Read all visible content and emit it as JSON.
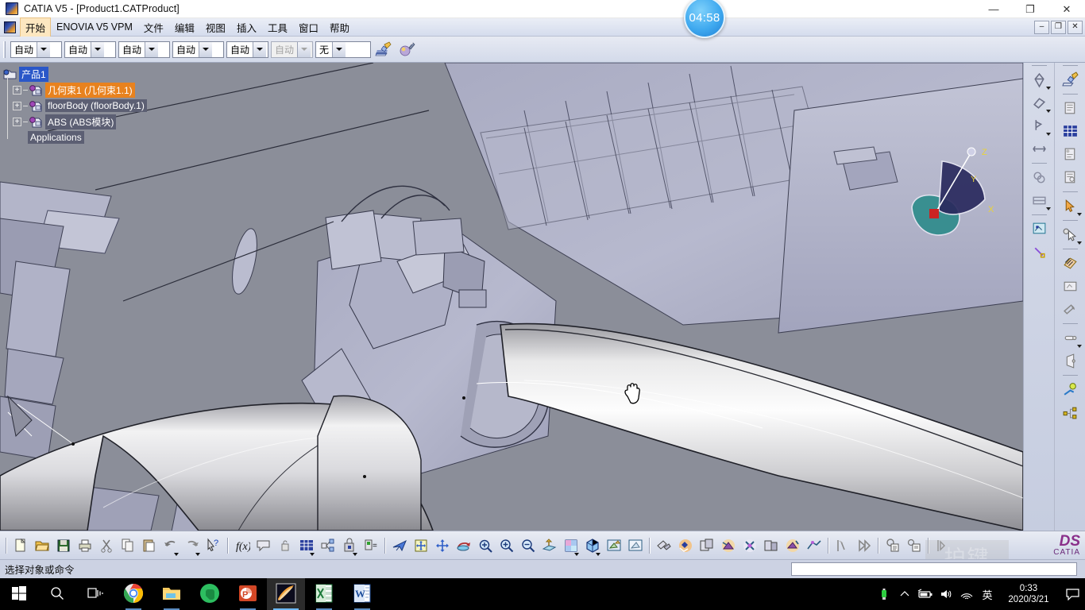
{
  "window": {
    "title": "CATIA V5 - [Product1.CATProduct]",
    "app_icon": "catia-icon",
    "minimize": "—",
    "maximize": "❐",
    "close": "✕"
  },
  "mdi": {
    "minimize": "–",
    "restore": "❐",
    "close": "✕"
  },
  "menubar": {
    "items": [
      {
        "label": "开始",
        "name": "menu-start",
        "active": true
      },
      {
        "label": "ENOVIA V5 VPM",
        "name": "menu-enovia",
        "active": false
      },
      {
        "label": "文件",
        "name": "menu-file",
        "active": false
      },
      {
        "label": "编辑",
        "name": "menu-edit",
        "active": false
      },
      {
        "label": "视图",
        "name": "menu-view",
        "active": false
      },
      {
        "label": "插入",
        "name": "menu-insert",
        "active": false
      },
      {
        "label": "工具",
        "name": "menu-tools",
        "active": false
      },
      {
        "label": "窗口",
        "name": "menu-window",
        "active": false
      },
      {
        "label": "帮助",
        "name": "menu-help",
        "active": false
      }
    ]
  },
  "toolbar_top": {
    "combos": [
      {
        "name": "combo-part-number",
        "value": "自动",
        "width": "c-w1",
        "disabled": false
      },
      {
        "name": "combo-instance-name",
        "value": "自动",
        "width": "c-w1",
        "disabled": false
      },
      {
        "name": "combo-nomenclature",
        "value": "自动",
        "width": "c-w1",
        "disabled": false
      },
      {
        "name": "combo-revision",
        "value": "自动",
        "width": "c-w1",
        "disabled": false
      },
      {
        "name": "combo-definition",
        "value": "自动",
        "width": "c-w2",
        "disabled": false
      },
      {
        "name": "combo-description",
        "value": "自动",
        "width": "c-w2",
        "disabled": true
      },
      {
        "name": "combo-filter",
        "value": "无",
        "width": "c-w3",
        "disabled": false
      }
    ],
    "tools": [
      {
        "name": "apply-material-icon"
      },
      {
        "name": "rendering-style-icon"
      }
    ]
  },
  "tree": {
    "nodes": [
      {
        "name": "tree-node-product1",
        "label": "产品1",
        "style": "lbl-sel",
        "expander": "",
        "icon": "product-icon",
        "indent": 0
      },
      {
        "name": "tree-node-geoset1",
        "label": "几何束1 (几何束1.1)",
        "style": "lbl-orange",
        "expander": "+",
        "icon": "part-icon",
        "indent": 1
      },
      {
        "name": "tree-node-floorbody",
        "label": "floorBody (floorBody.1)",
        "style": "lbl-plain",
        "expander": "+",
        "icon": "part-icon",
        "indent": 1
      },
      {
        "name": "tree-node-abs",
        "label": "ABS (ABS模块)",
        "style": "lbl-plain",
        "expander": "+",
        "icon": "part-icon",
        "indent": 1
      },
      {
        "name": "tree-node-applications",
        "label": "Applications",
        "style": "lbl-plain",
        "expander": "",
        "icon": "none",
        "indent": 1
      }
    ]
  },
  "viewport": {
    "compass": {
      "x_label": "X",
      "y_label": "Y",
      "z_label": "Z"
    },
    "axis_triad": {
      "x_label": "x",
      "y_label": "y",
      "z_label": "z"
    },
    "cursor": "hand-cursor"
  },
  "timer": {
    "value": "04:58",
    "name": "session-timer-badge"
  },
  "right_toolbar_a": {
    "icons": [
      {
        "name": "separator"
      },
      {
        "name": "measure-item-icon",
        "caret": true
      },
      {
        "name": "measure-between-icon",
        "caret": true
      },
      {
        "name": "measure-inertia-icon",
        "caret": true
      },
      {
        "name": "measure-distance-icon",
        "caret": false
      },
      {
        "name": "separator"
      },
      {
        "name": "sectioning-icon",
        "caret": false
      },
      {
        "name": "clipping-icon",
        "caret": true
      },
      {
        "name": "separator"
      },
      {
        "name": "enhanced-scene-icon",
        "caret": false
      },
      {
        "name": "snap-icon",
        "caret": false
      }
    ]
  },
  "right_toolbar_b": {
    "icons": [
      {
        "name": "separator"
      },
      {
        "name": "apply-material-icon",
        "caret": false
      },
      {
        "name": "separator"
      },
      {
        "name": "catalog-browser-icon",
        "caret": false
      },
      {
        "name": "design-table-icon",
        "caret": false
      },
      {
        "name": "publication-icon",
        "caret": false
      },
      {
        "name": "knowledge-inspect-icon",
        "caret": false
      },
      {
        "name": "separator"
      },
      {
        "name": "select-arrow-icon",
        "caret": true
      },
      {
        "name": "separator"
      },
      {
        "name": "select-gear-icon",
        "caret": true
      },
      {
        "name": "separator"
      },
      {
        "name": "hatch-tool-icon",
        "caret": false
      },
      {
        "name": "scene-browser-icon",
        "caret": false
      },
      {
        "name": "annotation-icon",
        "caret": false
      },
      {
        "name": "separator"
      },
      {
        "name": "simulation-icon",
        "caret": true
      },
      {
        "name": "projector-icon",
        "caret": false
      },
      {
        "name": "separator"
      },
      {
        "name": "fitting-icon",
        "caret": false
      },
      {
        "name": "assembly-tree-icon",
        "caret": false
      }
    ]
  },
  "toolbar_bottom": {
    "icons": [
      {
        "name": "separator"
      },
      {
        "name": "new-file-icon",
        "caret": false
      },
      {
        "name": "open-file-icon",
        "caret": false
      },
      {
        "name": "save-file-icon",
        "caret": false
      },
      {
        "name": "print-icon",
        "caret": false
      },
      {
        "name": "cut-icon",
        "caret": false
      },
      {
        "name": "copy-icon",
        "caret": false
      },
      {
        "name": "paste-icon",
        "caret": false
      },
      {
        "name": "undo-icon",
        "caret": true
      },
      {
        "name": "redo-icon",
        "caret": true
      },
      {
        "name": "whats-this-help-icon",
        "caret": false
      },
      {
        "name": "separator"
      },
      {
        "name": "formula-icon",
        "caret": false
      },
      {
        "name": "comment-icon",
        "caret": false
      },
      {
        "name": "lock-unlock-icon",
        "caret": false
      },
      {
        "name": "design-table-icon",
        "caret": true
      },
      {
        "name": "knowledge-pattern-icon",
        "caret": false
      },
      {
        "name": "lock-knowledge-icon",
        "caret": true
      },
      {
        "name": "equivalent-dimensions-icon",
        "caret": false
      },
      {
        "name": "separator"
      },
      {
        "name": "fly-mode-icon",
        "caret": false
      },
      {
        "name": "fit-all-in-icon",
        "caret": false
      },
      {
        "name": "pan-icon",
        "caret": false
      },
      {
        "name": "rotate-icon",
        "caret": false
      },
      {
        "name": "zoom-in-out-icon",
        "caret": false
      },
      {
        "name": "zoom-in-icon",
        "caret": false
      },
      {
        "name": "zoom-out-icon",
        "caret": false
      },
      {
        "name": "normal-view-icon",
        "caret": false
      },
      {
        "name": "multi-view-icon",
        "caret": true
      },
      {
        "name": "isometric-view-icon",
        "caret": true
      },
      {
        "name": "render-style-icon",
        "caret": false
      },
      {
        "name": "hide-show-icon",
        "caret": false
      },
      {
        "name": "separator"
      },
      {
        "name": "assembly-design-icon",
        "caret": false
      },
      {
        "name": "generative-design-icon",
        "caret": false
      },
      {
        "name": "dmu-navigator-icon",
        "caret": false
      },
      {
        "name": "dmu-space-analysis-icon",
        "caret": false
      },
      {
        "name": "dmu-kinematics-icon",
        "caret": false
      },
      {
        "name": "dmu-fitting-icon",
        "caret": false
      },
      {
        "name": "part-design-icon",
        "caret": false
      },
      {
        "name": "wireframe-surface-icon",
        "caret": false
      },
      {
        "name": "separator"
      },
      {
        "name": "section-tool-icon",
        "caret": false
      },
      {
        "name": "fast-forward-icon",
        "caret": false
      },
      {
        "name": "separator"
      },
      {
        "name": "capture-icon",
        "caret": false
      },
      {
        "name": "album-icon",
        "caret": false
      },
      {
        "name": "separator"
      },
      {
        "name": "play-all-icon",
        "caret": false
      }
    ],
    "watermark": "护键",
    "logo_top": "DS",
    "logo_bottom": "CATIA"
  },
  "statusbar": {
    "message": "选择对象或命令",
    "input_value": ""
  },
  "taskbar": {
    "items": [
      {
        "name": "start-button",
        "icon": "windows-logo-icon",
        "state": ""
      },
      {
        "name": "search-button",
        "icon": "search-icon",
        "state": ""
      },
      {
        "name": "task-view-button",
        "icon": "task-view-icon",
        "state": ""
      },
      {
        "name": "taskbar-chrome",
        "icon": "chrome-icon",
        "state": "run"
      },
      {
        "name": "taskbar-file-explorer",
        "icon": "folder-icon",
        "state": "run"
      },
      {
        "name": "taskbar-evernote",
        "icon": "evernote-icon",
        "state": ""
      },
      {
        "name": "taskbar-powerpoint",
        "icon": "powerpoint-icon",
        "state": "run"
      },
      {
        "name": "taskbar-catia",
        "icon": "catia-icon",
        "state": "active"
      },
      {
        "name": "taskbar-excel",
        "icon": "excel-icon",
        "state": "run"
      },
      {
        "name": "taskbar-word",
        "icon": "word-icon",
        "state": "run"
      }
    ],
    "tray": {
      "usb": "usb-icon",
      "chevron": "chevron-up-icon",
      "battery": "battery-icon",
      "volume": "volume-icon",
      "wifi": "wifi-icon",
      "ime": "英",
      "time": "0:33",
      "date": "2020/3/21",
      "notification": "notification-icon"
    }
  }
}
